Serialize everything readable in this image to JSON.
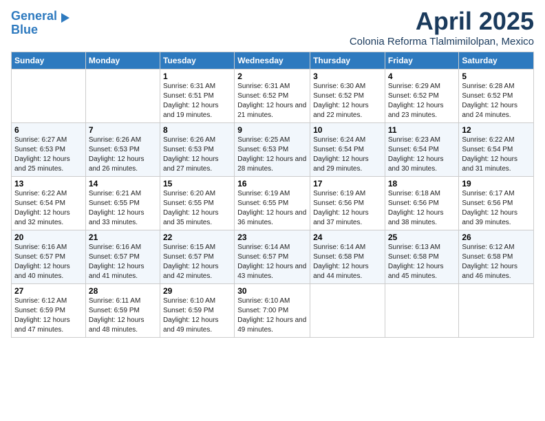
{
  "header": {
    "logo_line1": "General",
    "logo_line2": "Blue",
    "month_title": "April 2025",
    "subtitle": "Colonia Reforma Tlalmimilolpan, Mexico"
  },
  "days_of_week": [
    "Sunday",
    "Monday",
    "Tuesday",
    "Wednesday",
    "Thursday",
    "Friday",
    "Saturday"
  ],
  "weeks": [
    [
      {
        "day": "",
        "info": ""
      },
      {
        "day": "",
        "info": ""
      },
      {
        "day": "1",
        "info": "Sunrise: 6:31 AM\nSunset: 6:51 PM\nDaylight: 12 hours and 19 minutes."
      },
      {
        "day": "2",
        "info": "Sunrise: 6:31 AM\nSunset: 6:52 PM\nDaylight: 12 hours and 21 minutes."
      },
      {
        "day": "3",
        "info": "Sunrise: 6:30 AM\nSunset: 6:52 PM\nDaylight: 12 hours and 22 minutes."
      },
      {
        "day": "4",
        "info": "Sunrise: 6:29 AM\nSunset: 6:52 PM\nDaylight: 12 hours and 23 minutes."
      },
      {
        "day": "5",
        "info": "Sunrise: 6:28 AM\nSunset: 6:52 PM\nDaylight: 12 hours and 24 minutes."
      }
    ],
    [
      {
        "day": "6",
        "info": "Sunrise: 6:27 AM\nSunset: 6:53 PM\nDaylight: 12 hours and 25 minutes."
      },
      {
        "day": "7",
        "info": "Sunrise: 6:26 AM\nSunset: 6:53 PM\nDaylight: 12 hours and 26 minutes."
      },
      {
        "day": "8",
        "info": "Sunrise: 6:26 AM\nSunset: 6:53 PM\nDaylight: 12 hours and 27 minutes."
      },
      {
        "day": "9",
        "info": "Sunrise: 6:25 AM\nSunset: 6:53 PM\nDaylight: 12 hours and 28 minutes."
      },
      {
        "day": "10",
        "info": "Sunrise: 6:24 AM\nSunset: 6:54 PM\nDaylight: 12 hours and 29 minutes."
      },
      {
        "day": "11",
        "info": "Sunrise: 6:23 AM\nSunset: 6:54 PM\nDaylight: 12 hours and 30 minutes."
      },
      {
        "day": "12",
        "info": "Sunrise: 6:22 AM\nSunset: 6:54 PM\nDaylight: 12 hours and 31 minutes."
      }
    ],
    [
      {
        "day": "13",
        "info": "Sunrise: 6:22 AM\nSunset: 6:54 PM\nDaylight: 12 hours and 32 minutes."
      },
      {
        "day": "14",
        "info": "Sunrise: 6:21 AM\nSunset: 6:55 PM\nDaylight: 12 hours and 33 minutes."
      },
      {
        "day": "15",
        "info": "Sunrise: 6:20 AM\nSunset: 6:55 PM\nDaylight: 12 hours and 35 minutes."
      },
      {
        "day": "16",
        "info": "Sunrise: 6:19 AM\nSunset: 6:55 PM\nDaylight: 12 hours and 36 minutes."
      },
      {
        "day": "17",
        "info": "Sunrise: 6:19 AM\nSunset: 6:56 PM\nDaylight: 12 hours and 37 minutes."
      },
      {
        "day": "18",
        "info": "Sunrise: 6:18 AM\nSunset: 6:56 PM\nDaylight: 12 hours and 38 minutes."
      },
      {
        "day": "19",
        "info": "Sunrise: 6:17 AM\nSunset: 6:56 PM\nDaylight: 12 hours and 39 minutes."
      }
    ],
    [
      {
        "day": "20",
        "info": "Sunrise: 6:16 AM\nSunset: 6:57 PM\nDaylight: 12 hours and 40 minutes."
      },
      {
        "day": "21",
        "info": "Sunrise: 6:16 AM\nSunset: 6:57 PM\nDaylight: 12 hours and 41 minutes."
      },
      {
        "day": "22",
        "info": "Sunrise: 6:15 AM\nSunset: 6:57 PM\nDaylight: 12 hours and 42 minutes."
      },
      {
        "day": "23",
        "info": "Sunrise: 6:14 AM\nSunset: 6:57 PM\nDaylight: 12 hours and 43 minutes."
      },
      {
        "day": "24",
        "info": "Sunrise: 6:14 AM\nSunset: 6:58 PM\nDaylight: 12 hours and 44 minutes."
      },
      {
        "day": "25",
        "info": "Sunrise: 6:13 AM\nSunset: 6:58 PM\nDaylight: 12 hours and 45 minutes."
      },
      {
        "day": "26",
        "info": "Sunrise: 6:12 AM\nSunset: 6:58 PM\nDaylight: 12 hours and 46 minutes."
      }
    ],
    [
      {
        "day": "27",
        "info": "Sunrise: 6:12 AM\nSunset: 6:59 PM\nDaylight: 12 hours and 47 minutes."
      },
      {
        "day": "28",
        "info": "Sunrise: 6:11 AM\nSunset: 6:59 PM\nDaylight: 12 hours and 48 minutes."
      },
      {
        "day": "29",
        "info": "Sunrise: 6:10 AM\nSunset: 6:59 PM\nDaylight: 12 hours and 49 minutes."
      },
      {
        "day": "30",
        "info": "Sunrise: 6:10 AM\nSunset: 7:00 PM\nDaylight: 12 hours and 49 minutes."
      },
      {
        "day": "",
        "info": ""
      },
      {
        "day": "",
        "info": ""
      },
      {
        "day": "",
        "info": ""
      }
    ]
  ]
}
